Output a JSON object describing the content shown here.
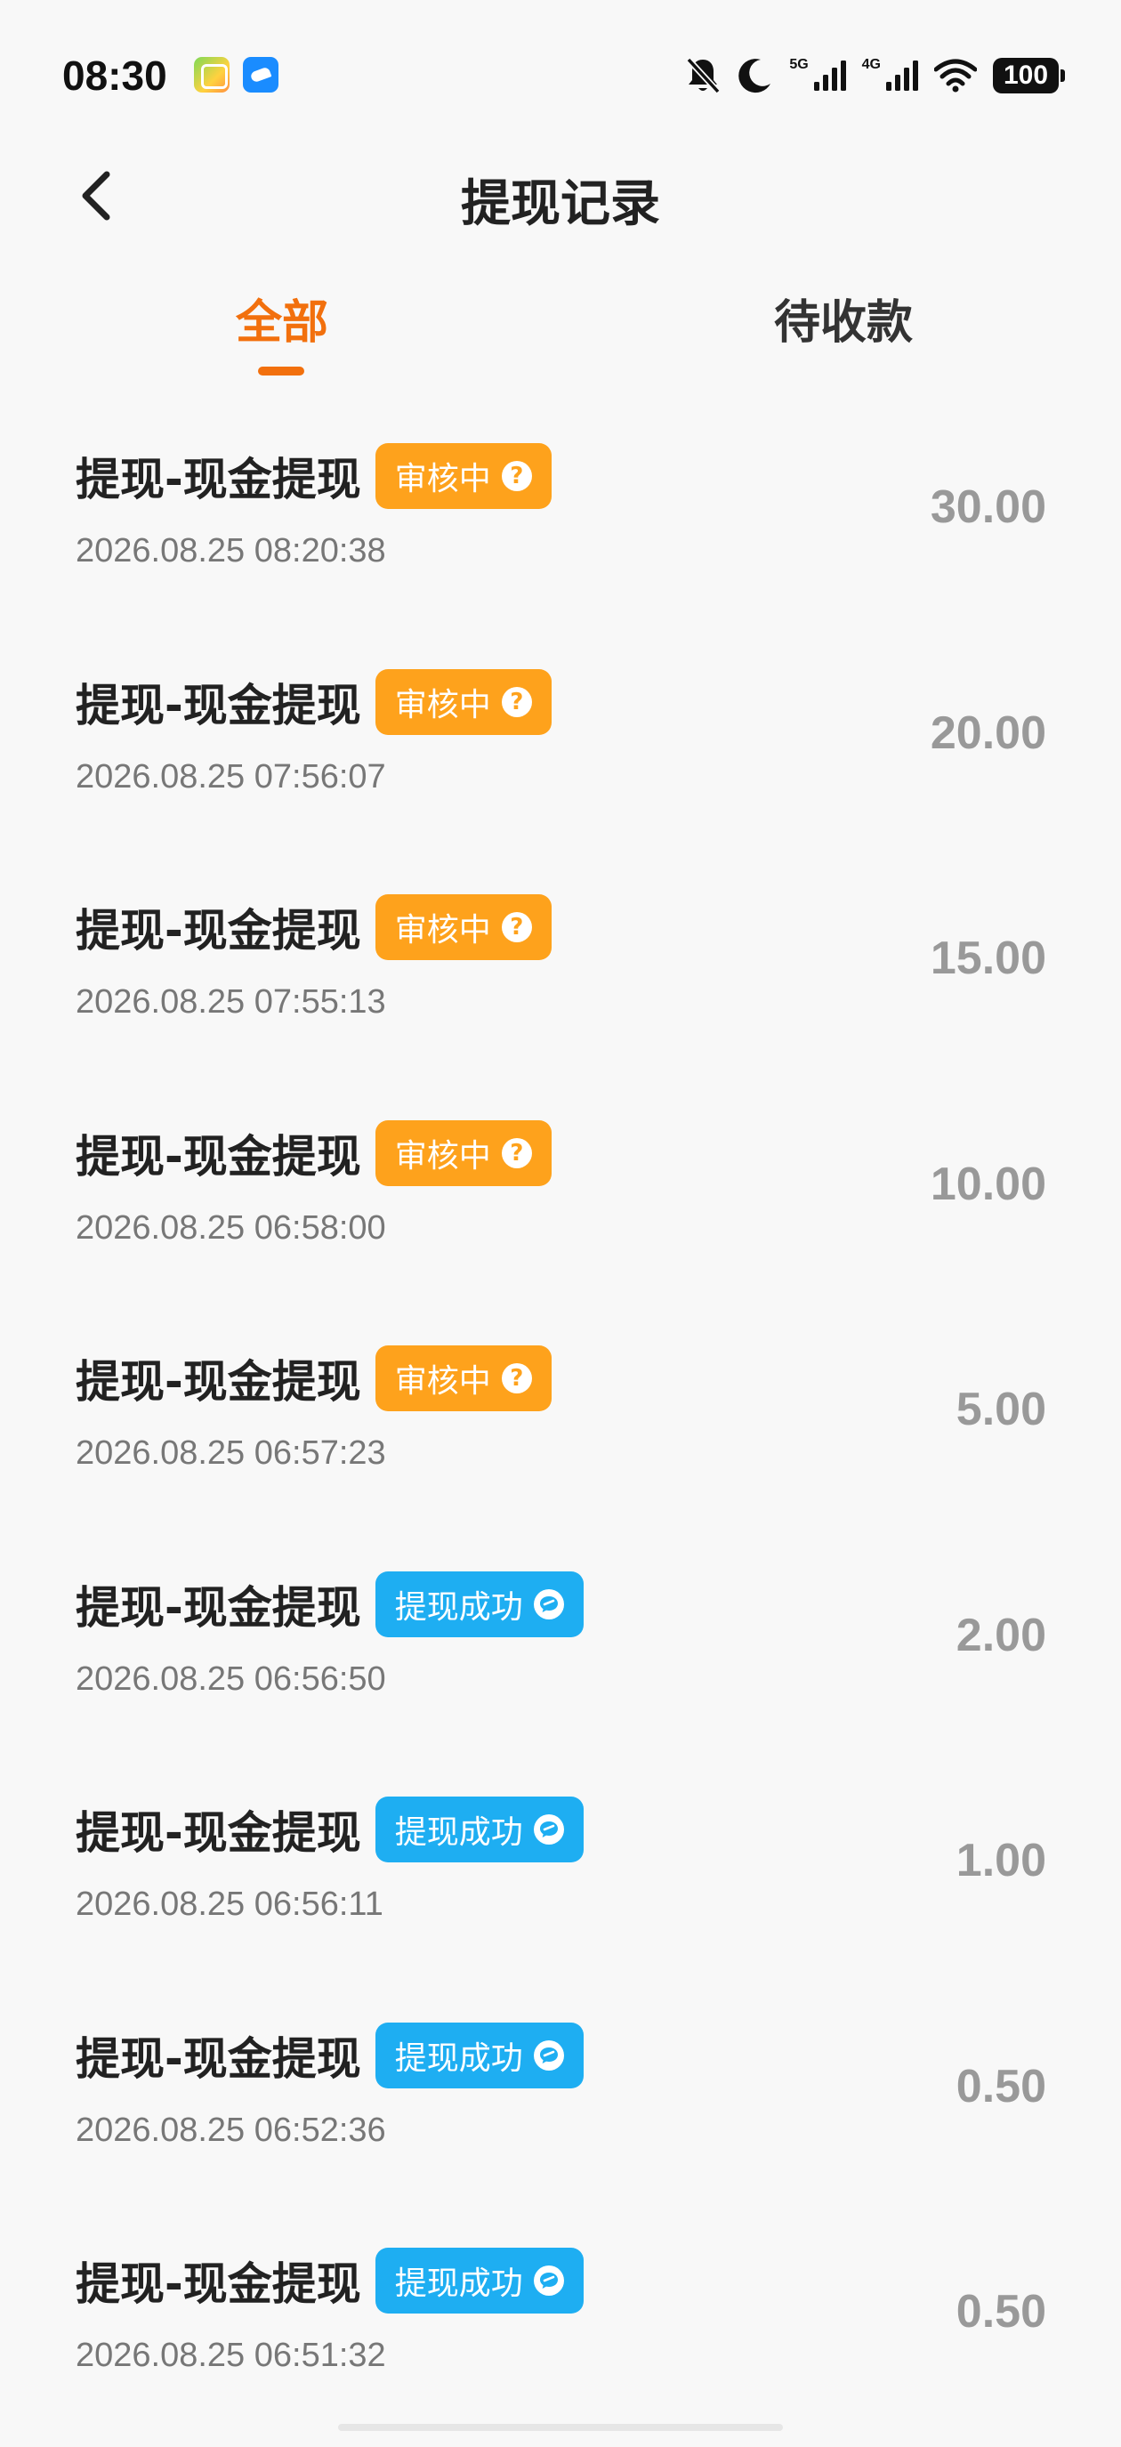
{
  "status_bar": {
    "time": "08:30",
    "net1": "5G",
    "net2": "4G",
    "battery": "100",
    "icons": [
      "mute-bell-icon",
      "moon-icon",
      "signal-icon",
      "signal-icon",
      "wifi-icon",
      "battery-icon"
    ]
  },
  "header": {
    "title": "提现记录",
    "back_icon": "chevron-left-icon"
  },
  "tabs": [
    {
      "label": "全部",
      "active": true
    },
    {
      "label": "待收款",
      "active": false
    }
  ],
  "colors": {
    "accent": "#f2700d",
    "review_badge": "#fea21c",
    "success_badge": "#1eaef2",
    "amount": "#999999",
    "time": "#777777"
  },
  "records": [
    {
      "title": "提现-现金提现",
      "status": "审核中",
      "status_type": "review",
      "status_icon": "question-icon",
      "time": "2026.08.25 08:20:38",
      "amount": "30.00"
    },
    {
      "title": "提现-现金提现",
      "status": "审核中",
      "status_type": "review",
      "status_icon": "question-icon",
      "time": "2026.08.25 07:56:07",
      "amount": "20.00"
    },
    {
      "title": "提现-现金提现",
      "status": "审核中",
      "status_type": "review",
      "status_icon": "question-icon",
      "time": "2026.08.25 07:55:13",
      "amount": "15.00"
    },
    {
      "title": "提现-现金提现",
      "status": "审核中",
      "status_type": "review",
      "status_icon": "question-icon",
      "time": "2026.08.25 06:58:00",
      "amount": "10.00"
    },
    {
      "title": "提现-现金提现",
      "status": "审核中",
      "status_type": "review",
      "status_icon": "question-icon",
      "time": "2026.08.25 06:57:23",
      "amount": "5.00"
    },
    {
      "title": "提现-现金提现",
      "status": "提现成功",
      "status_type": "success",
      "status_icon": "chat-bubble-icon",
      "time": "2026.08.25 06:56:50",
      "amount": "2.00"
    },
    {
      "title": "提现-现金提现",
      "status": "提现成功",
      "status_type": "success",
      "status_icon": "chat-bubble-icon",
      "time": "2026.08.25 06:56:11",
      "amount": "1.00"
    },
    {
      "title": "提现-现金提现",
      "status": "提现成功",
      "status_type": "success",
      "status_icon": "chat-bubble-icon",
      "time": "2026.08.25 06:52:36",
      "amount": "0.50"
    },
    {
      "title": "提现-现金提现",
      "status": "提现成功",
      "status_type": "success",
      "status_icon": "chat-bubble-icon",
      "time": "2026.08.25 06:51:32",
      "amount": "0.50"
    }
  ]
}
